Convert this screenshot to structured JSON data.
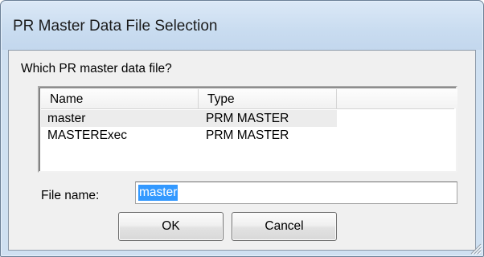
{
  "window": {
    "title": "PR Master Data File Selection"
  },
  "dialog": {
    "prompt": "Which PR master data file?",
    "list": {
      "columns": [
        {
          "label": "Name"
        },
        {
          "label": "Type"
        }
      ],
      "rows": [
        {
          "name": "master",
          "type": "PRM MASTER",
          "selected": true
        },
        {
          "name": "MASTERExec",
          "type": "PRM MASTER",
          "selected": false
        }
      ]
    },
    "file_name_label": "File name:",
    "file_name_value": "master",
    "ok_label": "OK",
    "cancel_label": "Cancel"
  },
  "colors": {
    "titlebar": "#cfe0f1",
    "selection_highlight": "#3399ff",
    "client_background": "#f0f0f0"
  },
  "icons": {
    "resize": "resize-grip-icon"
  }
}
